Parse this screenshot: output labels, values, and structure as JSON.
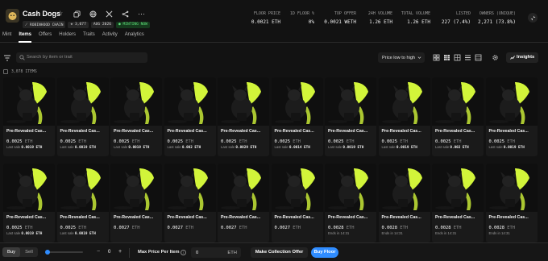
{
  "collection": {
    "name": "Cash Dogs",
    "tags": [
      {
        "label": "⟋ ROBINHOOD CHAIN",
        "kind": "chain"
      },
      {
        "label": "◈ 3,077",
        "kind": "count"
      },
      {
        "label": "AUG 2026",
        "kind": "date"
      },
      {
        "label": "● MINTING NOW",
        "kind": "mint"
      }
    ]
  },
  "header_icons": [
    "copy-icon",
    "globe-icon",
    "x-icon",
    "share-icon",
    "more-icon"
  ],
  "stats": [
    {
      "label": "FLOOR PRICE",
      "value": "0.0021 ETH"
    },
    {
      "label": "1D FLOOR %",
      "value": "0%"
    },
    {
      "label": "TOP OFFER",
      "value": "0.0021 WETH"
    },
    {
      "label": "24H VOLUME",
      "value": "1.26 ETH"
    },
    {
      "label": "TOTAL VOLUME",
      "value": "1.26 ETH"
    },
    {
      "label": "LISTED",
      "value": "227 (7.4%)"
    },
    {
      "label": "OWNERS (UNIQUE)",
      "value": "2,271 (73.8%)"
    }
  ],
  "tabs": [
    {
      "label": "Mint",
      "active": false
    },
    {
      "label": "Items",
      "active": true
    },
    {
      "label": "Offers",
      "active": false
    },
    {
      "label": "Holders",
      "active": false
    },
    {
      "label": "Traits",
      "active": false
    },
    {
      "label": "Activity",
      "active": false
    },
    {
      "label": "Analytics",
      "active": false
    }
  ],
  "toolbar": {
    "search_placeholder": "Search by item or trait",
    "sort_label": "Price low to high",
    "insights_label": "Insights"
  },
  "items_count": "3,078 ITEMS",
  "items": [
    {
      "name": "Pre-Revealed Cas...",
      "price": "0.0025",
      "unit": "ETH",
      "last_label": "Last sale",
      "last_value": "0.0019 ETH"
    },
    {
      "name": "Pre-Revealed Cas...",
      "price": "0.0025",
      "unit": "ETH",
      "last_label": "Last sale",
      "last_value": "0.0019 ETH"
    },
    {
      "name": "Pre-Revealed Cas...",
      "price": "0.0025",
      "unit": "ETH",
      "last_label": "Last sale",
      "last_value": "0.0019 ETH"
    },
    {
      "name": "Pre-Revealed Cas...",
      "price": "0.0025",
      "unit": "ETH",
      "last_label": "Last sale",
      "last_value": "0.002 ETH"
    },
    {
      "name": "Pre-Revealed Cas...",
      "price": "0.0025",
      "unit": "ETH",
      "last_label": "Last sale",
      "last_value": "0.0029 ETH"
    },
    {
      "name": "Pre-Revealed Cas...",
      "price": "0.0025",
      "unit": "ETH",
      "last_label": "Last sale",
      "last_value": "0.0014 ETH"
    },
    {
      "name": "Pre-Revealed Cas...",
      "price": "0.0025",
      "unit": "ETH",
      "last_label": "Last sale",
      "last_value": "0.0019 ETH"
    },
    {
      "name": "Pre-Revealed Cas...",
      "price": "0.0025",
      "unit": "ETH",
      "last_label": "Last sale",
      "last_value": "0.0019 ETH"
    },
    {
      "name": "Pre-Revealed Cas...",
      "price": "0.0025",
      "unit": "ETH",
      "last_label": "Last sale",
      "last_value": "0.002 ETH"
    },
    {
      "name": "Pre-Revealed Cas...",
      "price": "0.0025",
      "unit": "ETH",
      "last_label": "Last sale",
      "last_value": "0.0019 ETH"
    },
    {
      "name": "Pre-Revealed Cas...",
      "price": "0.0025",
      "unit": "ETH",
      "last_label": "Last sale",
      "last_value": "0.0019 ETH"
    },
    {
      "name": "Pre-Revealed Cas...",
      "price": "0.0025",
      "unit": "ETH",
      "last_label": "Last sale",
      "last_value": "0.0019 ETH"
    },
    {
      "name": "Pre-Revealed Cas...",
      "price": "0.0027",
      "unit": "ETH",
      "last_label": "",
      "last_value": ""
    },
    {
      "name": "Pre-Revealed Cas...",
      "price": "0.0027",
      "unit": "ETH",
      "last_label": "",
      "last_value": ""
    },
    {
      "name": "Pre-Revealed Cas...",
      "price": "0.0027",
      "unit": "ETH",
      "last_label": "",
      "last_value": ""
    },
    {
      "name": "Pre-Revealed Cas...",
      "price": "0.0027",
      "unit": "ETH",
      "last_label": "",
      "last_value": ""
    },
    {
      "name": "Pre-Revealed Cas...",
      "price": "0.0028",
      "unit": "ETH",
      "last_label": "Ends in 14:31",
      "last_value": ""
    },
    {
      "name": "Pre-Revealed Cas...",
      "price": "0.0028",
      "unit": "ETH",
      "last_label": "Ends in 14:31",
      "last_value": ""
    },
    {
      "name": "Pre-Revealed Cas...",
      "price": "0.0028",
      "unit": "ETH",
      "last_label": "Ends in 14:31",
      "last_value": ""
    },
    {
      "name": "Pre-Revealed Cas...",
      "price": "0.0028",
      "unit": "ETH",
      "last_label": "Ends in 14:31",
      "last_value": ""
    }
  ],
  "bottom_bar": {
    "buy_label": "Buy",
    "sell_label": "Sell",
    "qty_minus": "−",
    "quantity": "0",
    "qty_plus": "+",
    "max_price_label": "Max Price Per Item",
    "price_value": "0",
    "price_unit": "ETH",
    "offer_label": "Make Collection Offer",
    "floor_label": "Buy Floor"
  },
  "colors": {
    "accent": "#2f8cff",
    "lime": "#d2f53a",
    "mint_green": "#5fe07a"
  }
}
